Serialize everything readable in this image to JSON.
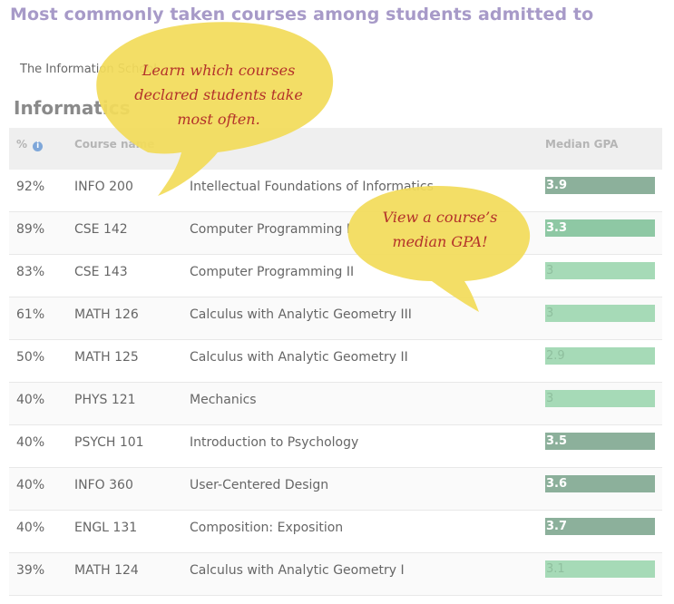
{
  "page": {
    "title": "Most commonly taken courses among students admitted to",
    "school": "The Information School",
    "major": "Informatics"
  },
  "table": {
    "headers": {
      "pct": "%",
      "info_icon": "i",
      "course": "Course name",
      "gpa": "Median GPA"
    },
    "rows": [
      {
        "pct": "92%",
        "code": "INFO 200",
        "name": "Intellectual Foundations of Informatics",
        "gpa": "3.9"
      },
      {
        "pct": "89%",
        "code": "CSE 142",
        "name": "Computer Programming I",
        "gpa": "3.3"
      },
      {
        "pct": "83%",
        "code": "CSE 143",
        "name": "Computer Programming II",
        "gpa": "3"
      },
      {
        "pct": "61%",
        "code": "MATH 126",
        "name": "Calculus with Analytic Geometry III",
        "gpa": "3"
      },
      {
        "pct": "50%",
        "code": "MATH 125",
        "name": "Calculus with Analytic Geometry II",
        "gpa": "2.9"
      },
      {
        "pct": "40%",
        "code": "PHYS 121",
        "name": "Mechanics",
        "gpa": "3"
      },
      {
        "pct": "40%",
        "code": "PSYCH 101",
        "name": "Introduction to Psychology",
        "gpa": "3.5"
      },
      {
        "pct": "40%",
        "code": "INFO 360",
        "name": "User-Centered Design",
        "gpa": "3.6"
      },
      {
        "pct": "40%",
        "code": "ENGL 131",
        "name": "Composition: Exposition",
        "gpa": "3.7"
      },
      {
        "pct": "39%",
        "code": "MATH 124",
        "name": "Calculus with Analytic Geometry I",
        "gpa": "3.1"
      }
    ]
  },
  "callouts": {
    "courses": [
      "Learn which courses",
      "declared students take",
      "most often."
    ],
    "gpa": [
      "View a course’s",
      "median GPA!"
    ]
  },
  "colors": {
    "title": "#a79ac8",
    "bubble_fill": "#f2dc5a",
    "bubble_text": "#b3312a",
    "gpa_dark": "#8cb09b",
    "gpa_mid": "#8ec8a4",
    "gpa_light": "#a6dab7"
  }
}
